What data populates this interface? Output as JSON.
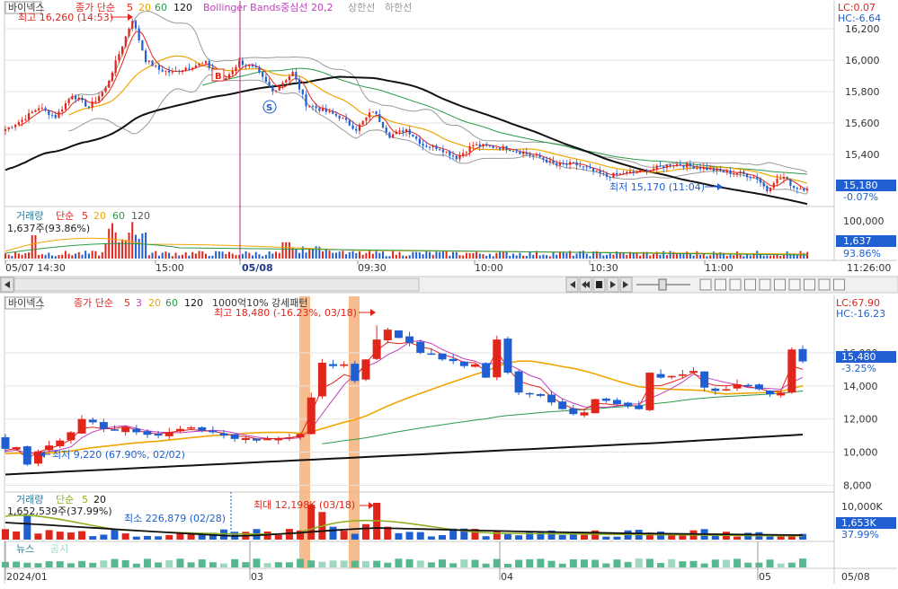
{
  "colors": {
    "up": "#e0251b",
    "down": "#1f5fd1",
    "ma5": "#e0251b",
    "ma20": "#f0a500",
    "ma60": "#2a9a4a",
    "ma120": "#111111",
    "bollinger": "#999999",
    "highlight": "#f7b27a",
    "priceBoxBlue": "#1f5fd1",
    "news": "#57b78f",
    "newsLight": "#9ed8c0"
  },
  "top_panel": {
    "title": "바이넥스",
    "legend": {
      "label": "종가 단순",
      "p5": "5",
      "p20": "20",
      "p60": "60",
      "p120": "120",
      "boll": "Bollinger Bands중심선 20,2",
      "upper": "상한선",
      "lower": "하한선"
    },
    "lc": "LC:0.07",
    "hc": "HC:-6.64",
    "high_annotation": "최고 16,260 (14:53)",
    "low_annotation": "최저 15,170 (11:04)",
    "price_box": "15,180",
    "price_change": "-0.07%",
    "buy_marker": "B",
    "sell_marker": "S",
    "volume_legend": {
      "label": "거래량",
      "simple": "단순",
      "p5": "5",
      "p20": "20",
      "p60": "60",
      "p120": "120"
    },
    "volume_value": "1,637주(93.86%)",
    "volume_box": "1,637",
    "volume_pct": "93.86%",
    "x_labels": [
      "05/07 14:30",
      "15:00",
      "05/08",
      "09:30",
      "10:00",
      "10:30",
      "11:00",
      "11:26:00"
    ],
    "toolbar_time": "11:26:00"
  },
  "bottom_panel": {
    "title": "바이넥스",
    "legend": {
      "label": "종가 단순",
      "p5": "5",
      "p3": "3",
      "p20": "20",
      "p60": "60",
      "p120": "120",
      "signal": "1000억10% 강세패턴"
    },
    "lc": "LC:67.90",
    "hc": "HC:-16.23",
    "high_annotation": "최고 18,480 (-16.23%, 03/18)",
    "low_annotation": "최저 9,220 (67.90%, 02/02)",
    "price_box": "15,480",
    "price_change": "-3.25%",
    "volume_legend": {
      "label": "거래량",
      "simple": "단순",
      "p5": "5",
      "p20": "20"
    },
    "volume_value": "1,652,539주(37.99%)",
    "volume_max": "최대 12,198K (03/18)",
    "volume_min": "최소 226,879 (02/28)",
    "volume_box": "1,653K",
    "volume_pct": "37.99%",
    "vol_axis_label": "10,000K",
    "news_label": "뉴스",
    "disclosure_label": "공시",
    "x_labels": [
      "2024/01",
      "03",
      "04",
      "05",
      "05/08"
    ]
  },
  "chart_data": [
    {
      "type": "candlestick",
      "title": "바이넥스",
      "timeframe": "intraday",
      "ylim": [
        15080,
        16280
      ],
      "yticks": [
        15400,
        15600,
        15800,
        16000,
        16200
      ],
      "ytick_labels": [
        "15,400",
        "15,600",
        "15,800",
        "16,000",
        "16,200"
      ],
      "x_labels": [
        "05/07 14:30",
        "15:00",
        "05/08",
        "09:30",
        "10:00",
        "10:30",
        "11:00"
      ],
      "keypoints": [
        [
          0,
          15560
        ],
        [
          5,
          15620
        ],
        [
          10,
          15700
        ],
        [
          15,
          15640
        ],
        [
          20,
          15780
        ],
        [
          25,
          15700
        ],
        [
          30,
          15820
        ],
        [
          34,
          16040
        ],
        [
          38,
          16260
        ],
        [
          42,
          16000
        ],
        [
          46,
          15940
        ],
        [
          50,
          15920
        ],
        [
          55,
          15960
        ],
        [
          60,
          15980
        ],
        [
          65,
          15860
        ],
        [
          70,
          15990
        ],
        [
          75,
          15940
        ],
        [
          80,
          15800
        ],
        [
          86,
          15920
        ],
        [
          90,
          15720
        ],
        [
          95,
          15680
        ],
        [
          100,
          15640
        ],
        [
          105,
          15560
        ],
        [
          110,
          15680
        ],
        [
          115,
          15520
        ],
        [
          120,
          15560
        ],
        [
          125,
          15460
        ],
        [
          130,
          15440
        ],
        [
          135,
          15380
        ],
        [
          140,
          15460
        ],
        [
          150,
          15440
        ],
        [
          160,
          15380
        ],
        [
          165,
          15330
        ],
        [
          170,
          15340
        ],
        [
          180,
          15260
        ],
        [
          185,
          15280
        ],
        [
          190,
          15290
        ],
        [
          200,
          15340
        ],
        [
          210,
          15310
        ],
        [
          215,
          15290
        ],
        [
          220,
          15280
        ],
        [
          225,
          15250
        ],
        [
          228,
          15170
        ],
        [
          230,
          15230
        ],
        [
          233,
          15255
        ],
        [
          236,
          15190
        ],
        [
          240,
          15180
        ]
      ],
      "last_price": 15180,
      "high": {
        "value": 16260,
        "time": "14:53"
      },
      "low": {
        "value": 15170,
        "time": "11:04"
      }
    },
    {
      "type": "candlestick",
      "title": "바이넥스",
      "timeframe": "daily",
      "ylim": [
        7700,
        18600
      ],
      "yticks": [
        8000,
        10000,
        12000,
        14000,
        16000
      ],
      "ytick_labels": [
        "8,000",
        "10,000",
        "12,000",
        "14,000",
        "16,000"
      ],
      "x_labels": [
        "2024/01",
        "03",
        "04",
        "05",
        "05/08"
      ],
      "closes": [
        10200,
        10300,
        9250,
        10050,
        10400,
        10700,
        11200,
        12000,
        11800,
        11400,
        11300,
        11500,
        11200,
        11050,
        11000,
        11200,
        11400,
        11500,
        11300,
        11200,
        11000,
        10800,
        10850,
        10700,
        10800,
        10850,
        10900,
        11100,
        13300,
        15400,
        15200,
        15300,
        14300,
        15600,
        16800,
        17400,
        16900,
        16600,
        16000,
        15900,
        15600,
        15500,
        15200,
        15300,
        14500,
        16800,
        14800,
        13600,
        13500,
        13400,
        13000,
        12600,
        12300,
        12400,
        13200,
        13100,
        12900,
        12800,
        12600,
        14800,
        14500,
        14600,
        14700,
        14900,
        13900,
        13700,
        13800,
        14100,
        14000,
        13800,
        13500,
        13600,
        16200,
        15480
      ],
      "last_price": 15480,
      "high": {
        "value": 18480,
        "date": "03/18"
      },
      "low": {
        "value": 9220,
        "date": "02/02"
      },
      "volume_max": {
        "value": "12,198K",
        "date": "03/18"
      },
      "volume_min": {
        "value": "226,879",
        "date": "02/28"
      }
    }
  ]
}
